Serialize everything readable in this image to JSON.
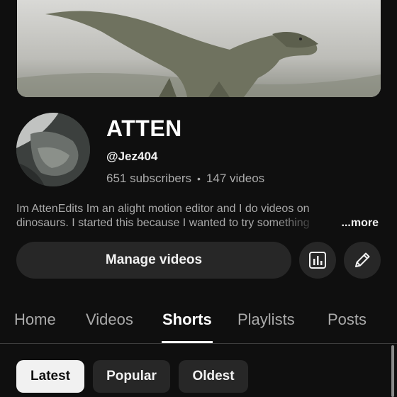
{
  "channel": {
    "name": "ATTEN",
    "handle": "@Jez404",
    "subscribers": "651 subscribers",
    "separator": "•",
    "videos": "147 videos",
    "description_line1": "Im AttenEdits Im an alight motion editor and I do videos on",
    "description_line2": "dinosaurs. I started this because I wanted to try something",
    "more_label": "...more"
  },
  "actions": {
    "manage_label": "Manage videos",
    "analytics_icon": "analytics-icon",
    "edit_icon": "pencil-icon"
  },
  "tabs": [
    {
      "label": "Home",
      "active": false
    },
    {
      "label": "Videos",
      "active": false
    },
    {
      "label": "Shorts",
      "active": true
    },
    {
      "label": "Playlists",
      "active": false
    },
    {
      "label": "Posts",
      "active": false
    }
  ],
  "chips": [
    {
      "label": "Latest",
      "selected": true
    },
    {
      "label": "Popular",
      "selected": false
    },
    {
      "label": "Oldest",
      "selected": false
    }
  ],
  "colors": {
    "background": "#0f0f0f",
    "surface": "#272727",
    "text_primary": "#f1f1f1",
    "text_secondary": "#aaaaaa"
  }
}
